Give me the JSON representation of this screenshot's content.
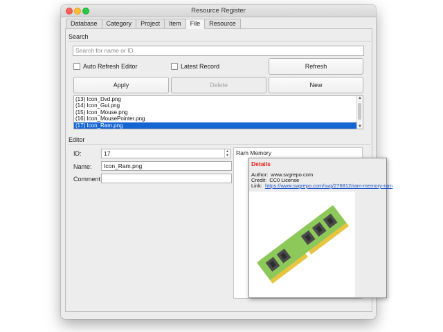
{
  "window": {
    "title": "Resource Register"
  },
  "tabs": [
    {
      "label": "Database"
    },
    {
      "label": "Category"
    },
    {
      "label": "Project"
    },
    {
      "label": "Item"
    },
    {
      "label": "File",
      "active": true
    },
    {
      "label": "Resource"
    }
  ],
  "search": {
    "label": "Search",
    "placeholder": "Search for name or ID",
    "auto_refresh_label": "Auto Refresh Editor",
    "latest_record_label": "Latest Record",
    "refresh_label": "Refresh",
    "apply_label": "Apply",
    "delete_label": "Delete",
    "new_label": "New"
  },
  "file_list": [
    {
      "text": "(13) Icon_Dvd.png"
    },
    {
      "text": "(14) Icon_Gui.png"
    },
    {
      "text": "(15) Icon_Mouse.png"
    },
    {
      "text": "(16) Icon_MousePointer.png"
    },
    {
      "text": "(17) Icon_Ram.png",
      "selected": true
    }
  ],
  "editor": {
    "label": "Editor",
    "id_label": "ID:",
    "id_value": "17",
    "name_label": "Name:",
    "name_value": "Icon_Ram.png",
    "comment_label": "Comment:",
    "comment_value": ""
  },
  "preview": {
    "title": "Ram Memory"
  },
  "details": {
    "heading": "Details",
    "author_label": "Author:",
    "author_value": "www.svgrepo.com",
    "credit_label": "Credit:",
    "credit_value": "CC0 License",
    "link_label": "Link:",
    "link_value": "https://www.svgrepo.com/svg/276812/ram-memory-ram"
  },
  "colors": {
    "selection": "#1464d2",
    "details_heading": "#e0231b",
    "link": "#1a52c8",
    "ram_board": "#8dc85a",
    "ram_chip": "#4a4a4a",
    "ram_pins": "#e8c440"
  },
  "icons": [
    "close-light",
    "minimize-light",
    "zoom-light",
    "ram-memory-image"
  ]
}
